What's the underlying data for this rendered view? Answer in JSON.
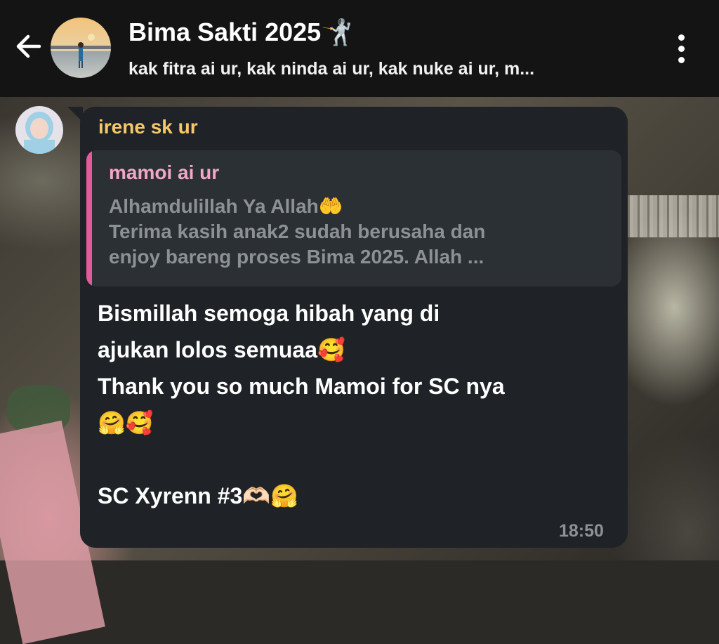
{
  "header": {
    "title": "Bima Sakti 2025",
    "title_emoji": "🤺",
    "subtitle": "kak fitra ai ur, kak ninda ai ur, kak nuke ai ur, m...",
    "back_icon": "arrow-left-icon",
    "menu_icon": "more-vertical-icon"
  },
  "message": {
    "sender": "irene sk ur",
    "quote": {
      "author": "mamoi ai ur",
      "line1": "Alhamdulillah Ya Allah",
      "line1_emoji": "🤲",
      "line2": "Terima kasih anak2 sudah berusaha dan",
      "line3": "enjoy bareng proses Bima 2025. Allah ..."
    },
    "body": {
      "line1": "Bismillah semoga hibah yang di",
      "line2": "ajukan lolos semuaa",
      "line2_emoji": "🥰",
      "line3": "Thank you so much Mamoi for SC nya",
      "line4_emoji": "🤗🥰",
      "line6": "SC Xyrenn #3",
      "line6_emoji": "🫶🏻🤗"
    },
    "time": "18:50"
  },
  "colors": {
    "header_bg": "#141414",
    "bubble_bg": "#1f2327",
    "sender_name": "#f5c86a",
    "quote_author": "#f2a7c9",
    "quote_bar": "#e25b9a",
    "muted_text": "#8d9194"
  }
}
